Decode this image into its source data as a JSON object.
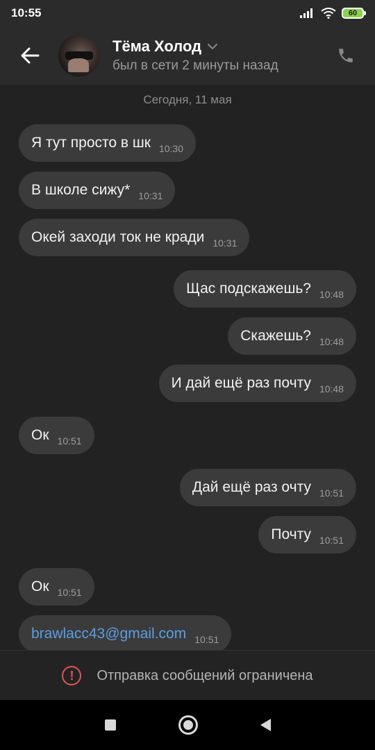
{
  "status_bar": {
    "time": "10:55",
    "battery": "60"
  },
  "header": {
    "name": "Тёма Холод",
    "status": "был в сети 2 минуты назад"
  },
  "date_separator": "Сегодня, 11 мая",
  "messages": [
    {
      "text": "Я тут просто в шк",
      "time": "10:30",
      "outgoing": false
    },
    {
      "text": "В школе сижу*",
      "time": "10:31",
      "outgoing": false
    },
    {
      "text": "Окей заходи ток не кради",
      "time": "10:31",
      "outgoing": false
    },
    {
      "text": "Щас подскажешь?",
      "time": "10:48",
      "outgoing": true
    },
    {
      "text": "Скажешь?",
      "time": "10:48",
      "outgoing": true
    },
    {
      "text": "И дай ещё раз почту",
      "time": "10:48",
      "outgoing": true
    },
    {
      "text": "Ок",
      "time": "10:51",
      "outgoing": false
    },
    {
      "text": "Дай ещё раз очту",
      "time": "10:51",
      "outgoing": true
    },
    {
      "text": "Почту",
      "time": "10:51",
      "outgoing": true
    },
    {
      "text": "Ок",
      "time": "10:51",
      "outgoing": false
    },
    {
      "text": "brawlacc43@gmail.com",
      "time": "10:51",
      "outgoing": false
    }
  ],
  "restriction": {
    "text": "Отправка сообщений ограничена",
    "color": "#e25557"
  },
  "colors": {
    "bubble": "#3b3b3c",
    "background": "#222223",
    "link": "#5b9ee0"
  }
}
